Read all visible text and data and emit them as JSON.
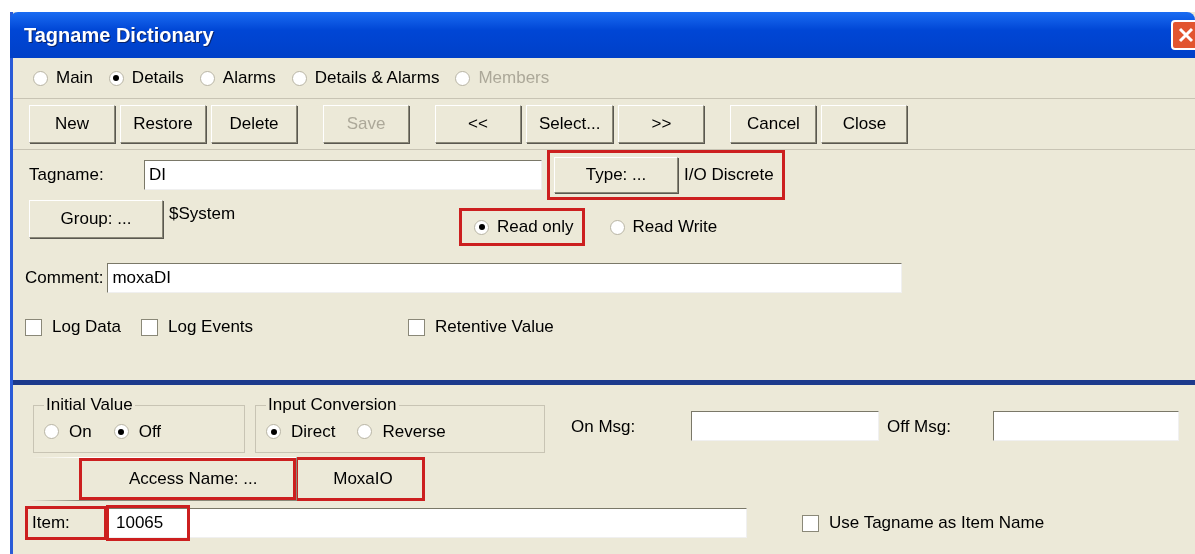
{
  "window": {
    "title": "Tagname Dictionary"
  },
  "views": [
    {
      "label": "Main",
      "selected": false,
      "disabled": false
    },
    {
      "label": "Details",
      "selected": true,
      "disabled": false
    },
    {
      "label": "Alarms",
      "selected": false,
      "disabled": false
    },
    {
      "label": "Details & Alarms",
      "selected": false,
      "disabled": false
    },
    {
      "label": "Members",
      "selected": false,
      "disabled": true
    }
  ],
  "toolbar": [
    [
      {
        "label": "New",
        "disabled": false
      },
      {
        "label": "Restore",
        "disabled": false
      },
      {
        "label": "Delete",
        "disabled": false
      }
    ],
    [
      {
        "label": "Save",
        "disabled": true
      }
    ],
    [
      {
        "label": "<<",
        "disabled": false
      },
      {
        "label": "Select...",
        "disabled": false
      },
      {
        "label": ">>",
        "disabled": false
      }
    ],
    [
      {
        "label": "Cancel",
        "disabled": false
      },
      {
        "label": "Close",
        "disabled": false
      }
    ]
  ],
  "tagname": {
    "label": "Tagname:",
    "value": "DI"
  },
  "type": {
    "button": "Type: ...",
    "value": "I/O Discrete",
    "highlighted": true
  },
  "group": {
    "button": "Group: ...",
    "value": "$System"
  },
  "access": [
    {
      "label": "Read only",
      "selected": true,
      "highlighted": true
    },
    {
      "label": "Read Write",
      "selected": false,
      "highlighted": false
    }
  ],
  "comment": {
    "label": "Comment:",
    "value": "moxaDI"
  },
  "options": [
    {
      "label": "Log Data",
      "checked": false
    },
    {
      "label": "Log Events",
      "checked": false
    },
    {
      "label": "Retentive Value",
      "checked": false
    }
  ],
  "initial_value": {
    "title": "Initial Value",
    "options": [
      {
        "label": "On",
        "selected": false
      },
      {
        "label": "Off",
        "selected": true
      }
    ]
  },
  "input_conversion": {
    "title": "Input Conversion",
    "options": [
      {
        "label": "Direct",
        "selected": true
      },
      {
        "label": "Reverse",
        "selected": false
      }
    ]
  },
  "on_msg": {
    "label": "On Msg:"
  },
  "off_msg": {
    "label": "Off Msg:"
  },
  "access_name": {
    "button": "Access Name: ...",
    "value": "MoxaIO",
    "highlighted": true
  },
  "item": {
    "label": "Item:",
    "value": "10065",
    "highlighted": true
  },
  "use_tagname": {
    "label": "Use Tagname as Item Name",
    "checked": false
  }
}
